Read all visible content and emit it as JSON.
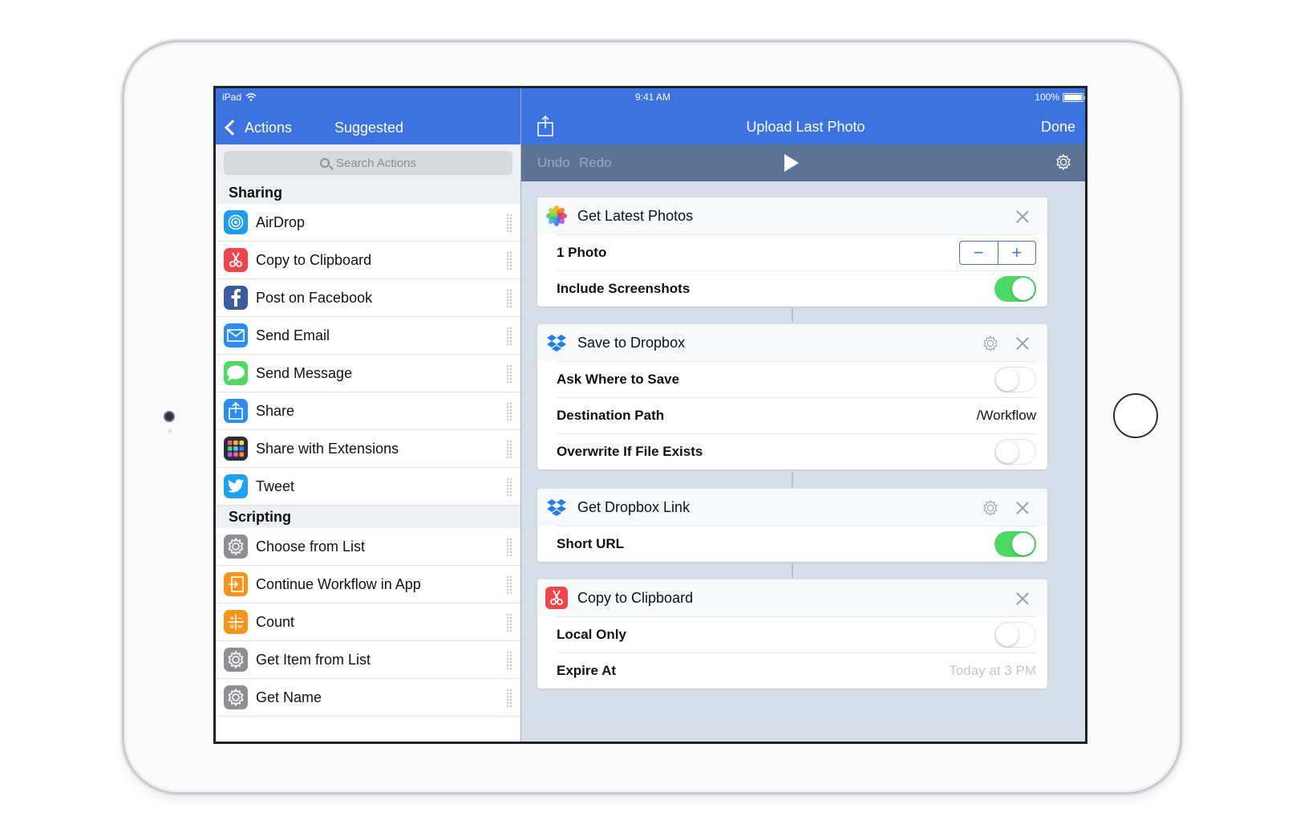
{
  "status": {
    "device": "iPad",
    "time": "9:41 AM",
    "battery": "100%"
  },
  "left_nav": {
    "back_label": "Actions",
    "title": "Suggested"
  },
  "search": {
    "placeholder": "Search Actions"
  },
  "sections": [
    {
      "header": "Sharing",
      "items": [
        {
          "label": "AirDrop",
          "icon": "airdrop-icon",
          "color": "#1e9cf0"
        },
        {
          "label": "Copy to Clipboard",
          "icon": "scissors-icon",
          "color": "#f0454d"
        },
        {
          "label": "Post on Facebook",
          "icon": "facebook-icon",
          "color": "#3b5aa0"
        },
        {
          "label": "Send Email",
          "icon": "mail-icon",
          "color": "#2d8cf0"
        },
        {
          "label": "Send Message",
          "icon": "message-icon",
          "color": "#4cd964"
        },
        {
          "label": "Share",
          "icon": "share-icon",
          "color": "#2d8cf0"
        },
        {
          "label": "Share with Extensions",
          "icon": "extensions-icon",
          "color": "#2c2f3a"
        },
        {
          "label": "Tweet",
          "icon": "twitter-icon",
          "color": "#1da1f2"
        }
      ]
    },
    {
      "header": "Scripting",
      "items": [
        {
          "label": "Choose from List",
          "icon": "gear-icon",
          "color": "#8e8e93"
        },
        {
          "label": "Continue Workflow in App",
          "icon": "continue-icon",
          "color": "#f7941d"
        },
        {
          "label": "Count",
          "icon": "calculator-icon",
          "color": "#f7941d"
        },
        {
          "label": "Get Item from List",
          "icon": "gear-icon",
          "color": "#8e8e93"
        },
        {
          "label": "Get Name",
          "icon": "gear-icon",
          "color": "#8e8e93"
        }
      ]
    }
  ],
  "right_nav": {
    "title": "Upload Last Photo",
    "done_label": "Done"
  },
  "toolbar": {
    "undo_label": "Undo",
    "redo_label": "Redo"
  },
  "cards": {
    "photos": {
      "title": "Get Latest Photos",
      "count_label": "1 Photo",
      "screenshots_label": "Include Screenshots",
      "screenshots_on": true
    },
    "dropbox": {
      "title": "Save to Dropbox",
      "ask_label": "Ask Where to Save",
      "ask_on": false,
      "path_label": "Destination Path",
      "path_value": "/Workflow",
      "overwrite_label": "Overwrite If File Exists",
      "overwrite_on": false
    },
    "link": {
      "title": "Get Dropbox Link",
      "short_label": "Short URL",
      "short_on": true
    },
    "clipboard": {
      "title": "Copy to Clipboard",
      "local_label": "Local Only",
      "local_on": false,
      "expire_label": "Expire At",
      "expire_placeholder": "Today at 3 PM"
    }
  },
  "colors": {
    "accent": "#3c73e0",
    "toggle_on": "#4cd964",
    "toolbar": "#5c7396"
  }
}
